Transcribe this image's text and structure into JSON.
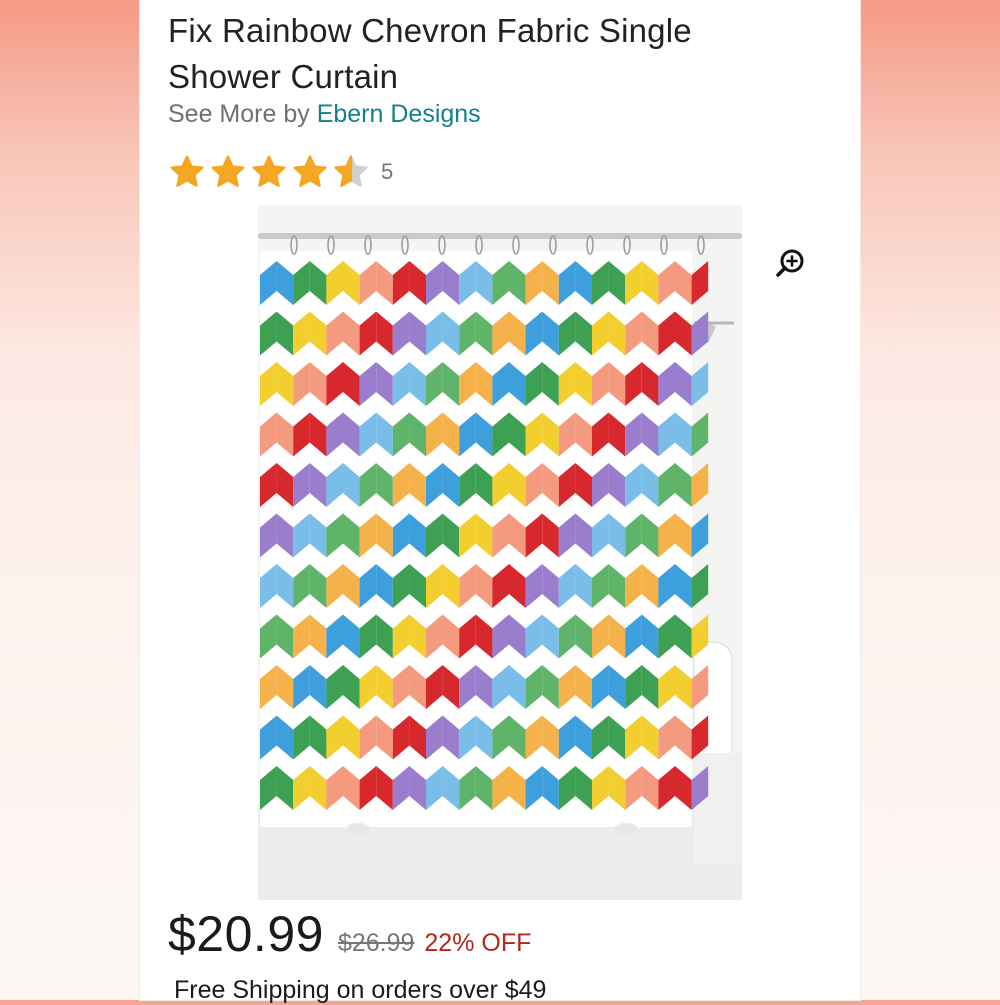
{
  "product": {
    "title": "Fix Rainbow Chevron Fabric Single Shower Curtain",
    "see_more_prefix": "See More by",
    "brand": "Ebern Designs",
    "rating_value": 4.5,
    "rating_max": 5,
    "rating_count": "5",
    "image_alt": "rainbow chevron shower curtain",
    "zoom_icon": "zoom-in-icon"
  },
  "pricing": {
    "price": "$20.99",
    "original_price": "$26.99",
    "discount": "22% OFF"
  },
  "shipping": {
    "text": "Free Shipping on orders over $49"
  },
  "colors": {
    "star": "#f5a623",
    "star_empty": "#d0d0d0",
    "brand_link": "#157f8b",
    "discount": "#b3261e",
    "chevrons": [
      "#3d9fdc",
      "#3ea053",
      "#f2cf2f",
      "#f49a7f",
      "#d7282d",
      "#9a7ecd",
      "#79bde8",
      "#5fb46a",
      "#f6b24a"
    ]
  }
}
